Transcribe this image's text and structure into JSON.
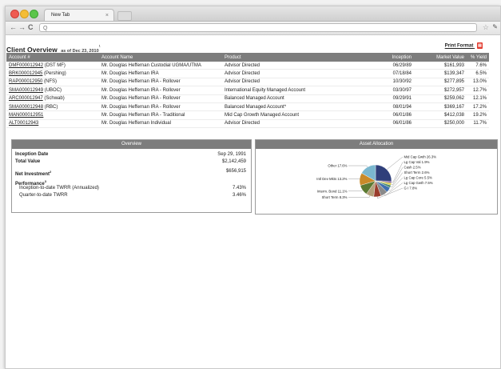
{
  "browser": {
    "tab_title": "New Tab",
    "tab_close": "×",
    "nav_back": "←",
    "nav_forward": "→",
    "reload": "C",
    "search_glyph": "Q"
  },
  "page": {
    "title": "Client Overview",
    "as_of": "as of Dec 23, 2010",
    "title_footnote": "1",
    "print_label": "Print Format"
  },
  "accounts": {
    "headers": [
      "Account #",
      "Account Name",
      "Product",
      "Inception",
      "Market Value",
      "% Yield"
    ],
    "rows": [
      {
        "num": "DMF000012942",
        "custodian": " (DST MF)",
        "name": "Mr. Douglas Heffernan Custodial UGMA/UTMA",
        "product": "Advisor Directed",
        "inception": "06/29/89",
        "value": "$161,993",
        "yield": "7.6%"
      },
      {
        "num": "BRK000012945",
        "custodian": " (Pershing)",
        "name": "Mr. Douglas Heffernan IRA",
        "product": "Advisor Directed",
        "inception": "07/18/84",
        "value": "$139,347",
        "yield": "6.5%"
      },
      {
        "num": "RAP000012950",
        "custodian": " (NFS)",
        "name": "Mr. Douglas Heffernan IRA - Rollover",
        "product": "Advisor Directed",
        "inception": "10/30/92",
        "value": "$277,895",
        "yield": "13.0%"
      },
      {
        "num": "SMA000012949",
        "custodian": " (UBOC)",
        "name": "Mr. Douglas Heffernan IRA - Rollover",
        "product": "International Equity Managed Account",
        "inception": "03/30/97",
        "value": "$272,957",
        "yield": "12.7%"
      },
      {
        "num": "ARC000012947",
        "custodian": " (Schwab)",
        "name": "Mr. Douglas Heffernan IRA - Rollover",
        "product": "Balanced Managed Account",
        "inception": "09/29/91",
        "value": "$259,062",
        "yield": "12.1%"
      },
      {
        "num": "SMA000012948",
        "custodian": " (RBC)",
        "name": "Mr. Douglas Heffernan IRA - Rollover",
        "product": "Balanced Managed Account*",
        "inception": "08/01/94",
        "value": "$369,167",
        "yield": "17.2%"
      },
      {
        "num": "MAN000012951",
        "custodian": "",
        "name": "Mr. Douglas Heffernan IRA - Traditional",
        "product": "Mid Cap Growth Managed Account",
        "inception": "06/01/86",
        "value": "$412,038",
        "yield": "19.2%"
      },
      {
        "num": "ALT00012943",
        "custodian": "",
        "name": "Mr. Douglas Heffernan Individual",
        "product": "Advisor Directed",
        "inception": "06/01/86",
        "value": "$250,000",
        "yield": "11.7%"
      }
    ]
  },
  "overview": {
    "title": "Overview",
    "inception_label": "Inception Date",
    "inception_value": "Sep 29, 1991",
    "total_label": "Total Value",
    "total_value": "$2,142,459",
    "net_label": "Net Investment",
    "net_footnote": "2",
    "net_value": "$656,915",
    "perf_label": "Performance",
    "perf_footnote": "3",
    "itd_label": "Inception-to-date TWRR  (Annualized)",
    "itd_value": "7.43%",
    "qtd_label": "Quarter-to-date TWRR",
    "qtd_value": "3.46%"
  },
  "allocation": {
    "title": "Asset Allocation",
    "chart_data": {
      "type": "pie",
      "slices": [
        {
          "label": "Mid Cap Gwth 26.3%",
          "value": 26.3,
          "color": "#2f3f7a"
        },
        {
          "label": "Lg Cap Val 1.9%",
          "value": 1.9,
          "color": "#6c4a8f"
        },
        {
          "label": "Cash 2.5%",
          "value": 2.5,
          "color": "#d6c84b"
        },
        {
          "label": "Short Term 2.6%",
          "value": 2.6,
          "color": "#4a8a6a"
        },
        {
          "label": "Lg Cap Core 5.5%",
          "value": 5.5,
          "color": "#3e6fb0"
        },
        {
          "label": "Lg Cap Gwth 7.5%",
          "value": 7.5,
          "color": "#8a8a8a"
        },
        {
          "label": "G I 7.8%",
          "value": 7.8,
          "color": "#9a3c2c"
        },
        {
          "label": "Short Term 8.3%",
          "value": 8.3,
          "color": "#b3a07a"
        },
        {
          "label": "Interm. Bond 11.1%",
          "value": 11.1,
          "color": "#5c7a32"
        },
        {
          "label": "Intl Dev Mkts 13.2%",
          "value": 13.2,
          "color": "#c98a2a"
        },
        {
          "label": "Other 17.6%",
          "value": 17.6,
          "color": "#7ab7cf"
        }
      ]
    }
  }
}
